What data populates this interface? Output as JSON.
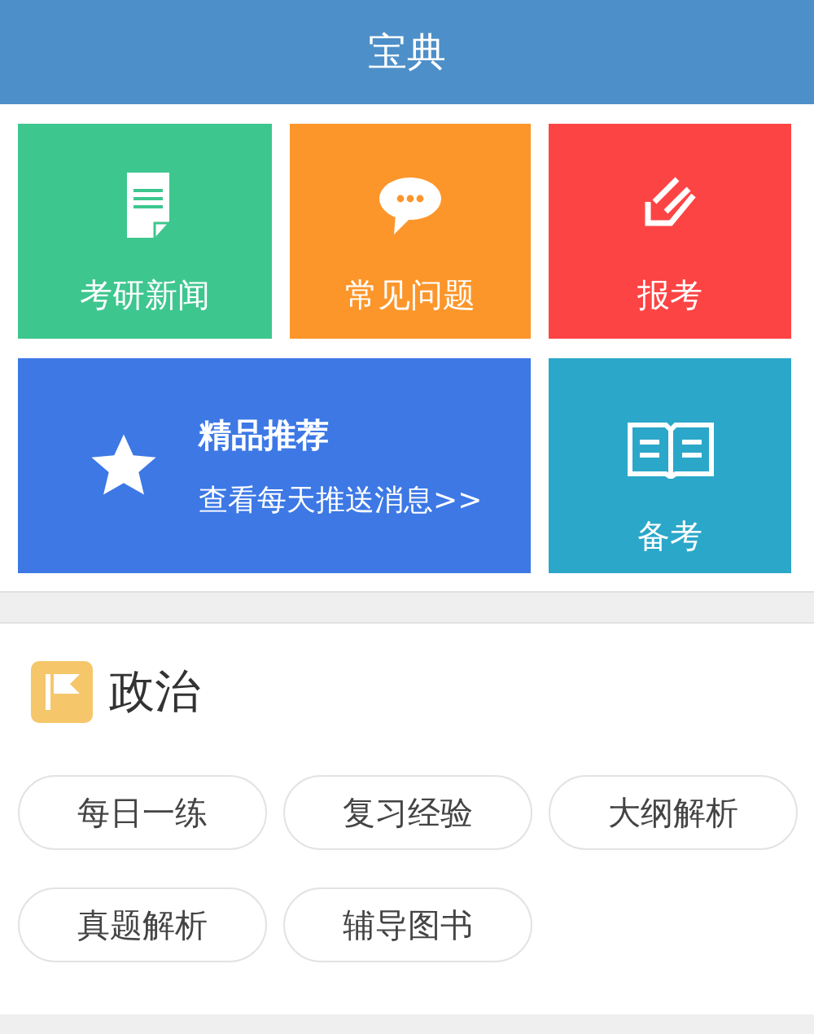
{
  "header": {
    "title": "宝典"
  },
  "tiles": [
    {
      "kind": "news",
      "label": "考研新闻",
      "color": "#3ec68f"
    },
    {
      "kind": "faq",
      "label": "常见问题",
      "color": "#fc962a"
    },
    {
      "kind": "signup",
      "label": "报考",
      "color": "#fd4444"
    },
    {
      "kind": "featured",
      "label": "精品推荐",
      "subtitle": "查看每天推送消息>>",
      "color": "#3d78e5"
    },
    {
      "kind": "prepare",
      "label": "备考",
      "color": "#2ba7c9"
    }
  ],
  "section": {
    "title": "政治",
    "links": [
      "每日一练",
      "复习经验",
      "大纲解析",
      "真题解析",
      "辅导图书"
    ]
  }
}
